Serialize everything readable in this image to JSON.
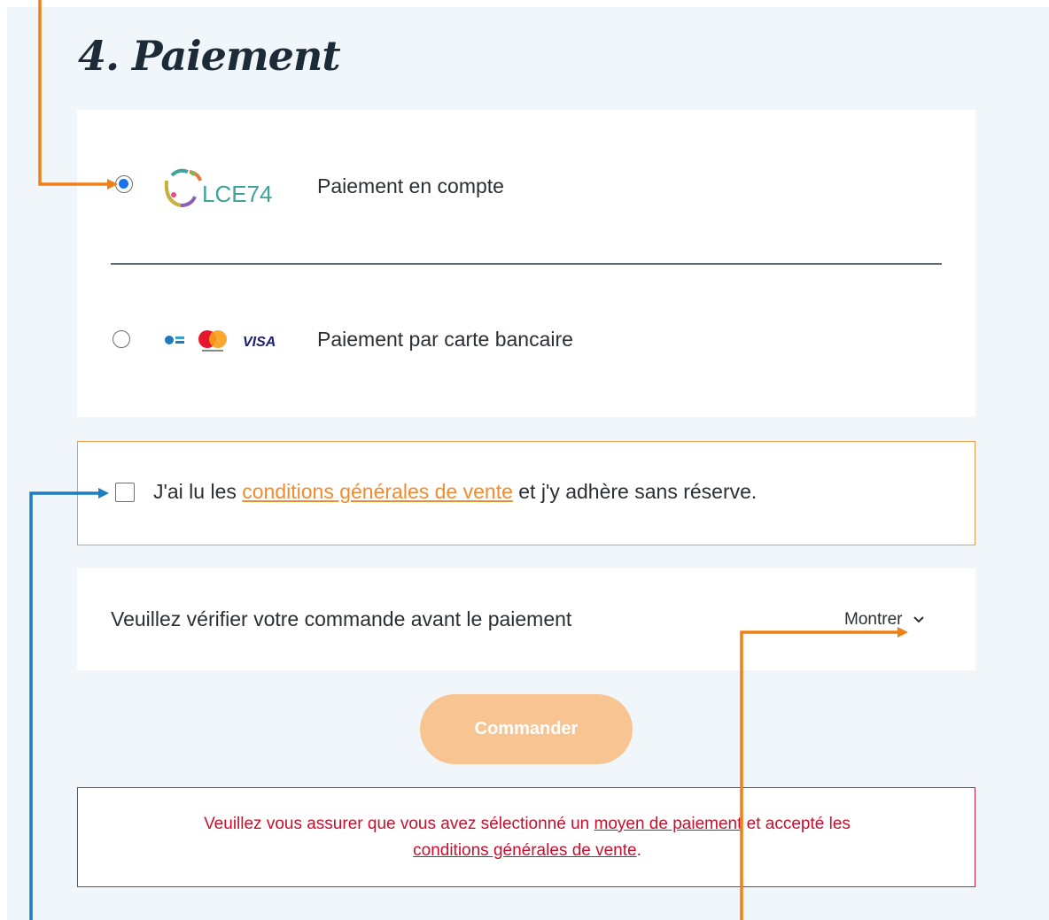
{
  "header": {
    "title": "4. Paiement"
  },
  "payment_methods": [
    {
      "label": "Paiement en compte",
      "logo_text": "LCE74",
      "selected": true,
      "icon": "lce74-logo"
    },
    {
      "label": "Paiement par carte bancaire",
      "logo_text": "VISA",
      "selected": false,
      "icon": "card-logos"
    }
  ],
  "terms": {
    "text_before": "J'ai lu les ",
    "link_text": "conditions générales de vente",
    "text_after": " et j'y adhère sans réserve.",
    "checked": false
  },
  "verify": {
    "text": "Veuillez vérifier votre commande avant le paiement",
    "toggle_label": "Montrer",
    "toggle_icon": "chevron-down-icon"
  },
  "order_button": {
    "label": "Commander"
  },
  "alert": {
    "text_before": "Veuillez vous assurer que vous avez sélectionné un ",
    "link1": "moyen de paiement",
    "text_middle": " et accepté les ",
    "link2": "conditions générales de vente",
    "text_after": "."
  },
  "colors": {
    "accent_orange": "#f28a2e",
    "annotation_orange": "#f07f14",
    "annotation_blue": "#1a7fc1",
    "error_red": "#c8102e",
    "button_disabled": "#f8c592"
  }
}
